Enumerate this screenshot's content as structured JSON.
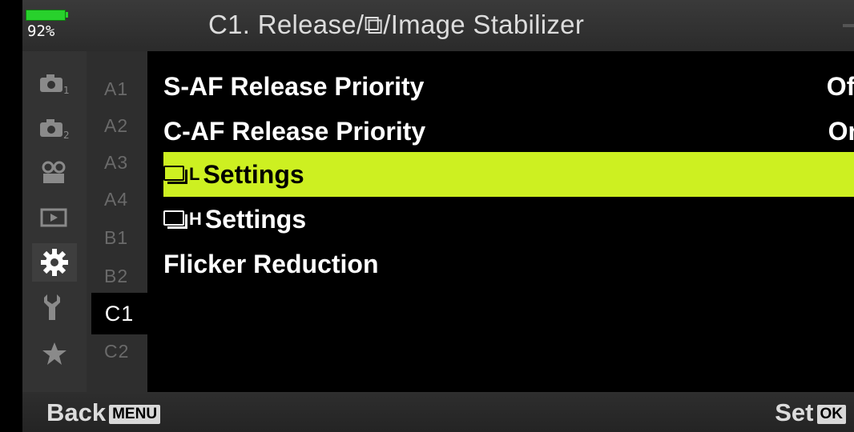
{
  "status": {
    "battery_percent": "92%",
    "battery_color": "#28d12c"
  },
  "header": {
    "title": "C1. Release/⧉/Image Stabilizer"
  },
  "sidebar": {
    "icons": [
      {
        "name": "camera-1-icon",
        "active": false
      },
      {
        "name": "camera-2-icon",
        "active": false
      },
      {
        "name": "video-icon",
        "active": false
      },
      {
        "name": "playback-icon",
        "active": false
      },
      {
        "name": "gear-icon",
        "active": true
      },
      {
        "name": "wrench-icon",
        "active": false
      },
      {
        "name": "star-icon",
        "active": false
      }
    ],
    "tabs": [
      "A1",
      "A2",
      "A3",
      "A4",
      "B1",
      "B2",
      "C1",
      "C2"
    ],
    "active_tab": "C1"
  },
  "menu": {
    "items": [
      {
        "label": "S-AF Release Priority",
        "value": "Off"
      },
      {
        "label": "C-AF Release Priority",
        "value": "On"
      },
      {
        "icon": "sequential-shooting-icon",
        "suffix": "L",
        "label": "Settings",
        "selected": true
      },
      {
        "icon": "sequential-shooting-icon",
        "suffix": "H",
        "label": "Settings"
      },
      {
        "label": "Flicker Reduction"
      }
    ],
    "highlight_color": "#cdf021"
  },
  "footer": {
    "back_label": "Back",
    "back_key": "MENU",
    "set_label": "Set",
    "set_key": "OK"
  }
}
